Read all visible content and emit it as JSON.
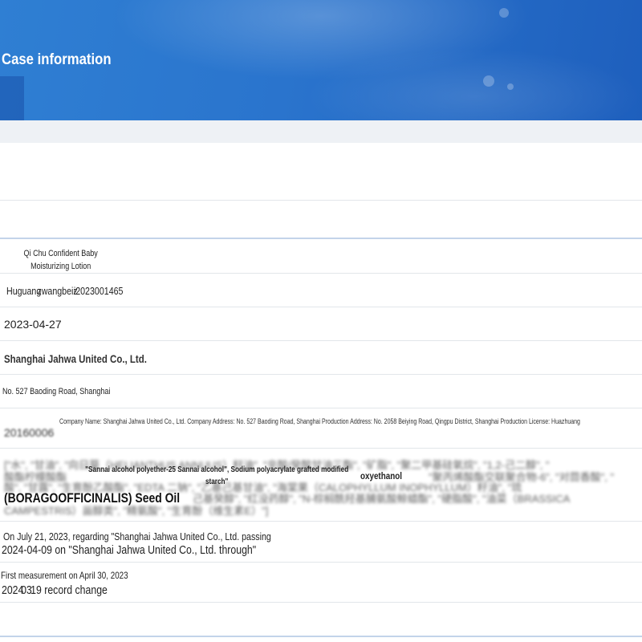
{
  "header": {
    "title": "Case information"
  },
  "fields": {
    "product_name": "Qi Chu Confident Baby Moisturizing Lotion",
    "record_number_a": "Huguang",
    "record_number_b": "zwangbeiz",
    "record_number_c": "i2023001465",
    "record_date": "2023-04-27",
    "registrant": "Shanghai Jahwa United Co., Ltd.",
    "registrant_address": "No. 527 Baoding Road, Shanghai",
    "producer_overlay": "Company Name: Shanghai Jahwa United Co., Ltd. Company Address: No. 527 Baoding Road, Shanghai Production Address: No. 2058 Beiying Road, Qingpu District, Shanghai Production License: Huazhuang",
    "producer_behind": "20160006",
    "ingredients_line1": "[\"水\", \"甘油\", \"向日葵（HELIANTHUS ANNUUS）籽油\", \"辛酸/癸酸甘油三酯\", \"矿脂\", \"聚二甲基硅氧烷\", \"1,2-己二醇\", \"",
    "ingredients_line2": "酸酯柠檬酸酯",
    "ingredients_line3": "酸\", \"甘露\", \"生育酚乙酸酯\", \"EDTA 二钠\", \"乙基己基甘油\", \"海棠果（CALOPHYLLUM INOPHYLLUM）籽油\", \"琉",
    "ingredients_line4": "CAMPESTRIS）甾醇类\", \"精氨酸\", \"生育酚（维生素E）\"]",
    "ingredients_mid": "己基癸醇\", \"红没药醇\", \"N-棕榈酰羟基脯氨酸鲸蜡酯\", \"硬脂酸\", \"油菜（BRASSICA",
    "ingredients_line2_tail": "\"聚丙烯酸酯交联聚合物-6\", \"对茴香酸\", \"",
    "overlay_ingredient_a": "\"Sannai alcohol polyether-25 Sannai alcohol\", Sodium polyacrylate grafted modified starch\"",
    "overlay_ingredient_b": "oxyethanol",
    "overlay_ingredient_c": "(BORAGOOFFICINALIS) Seed Oil",
    "change_note_1": "On July 21, 2023, regarding \"Shanghai Jahwa United Co., Ltd. passing",
    "change_note_2": "2024-04-09 on \"Shanghai Jahwa United Co., Ltd. through\"",
    "measure_1": "First measurement on April 30, 2023",
    "measure_2a": "2024",
    "measure_2b": "03",
    "measure_2c": "19",
    "measure_2d": "record change"
  }
}
